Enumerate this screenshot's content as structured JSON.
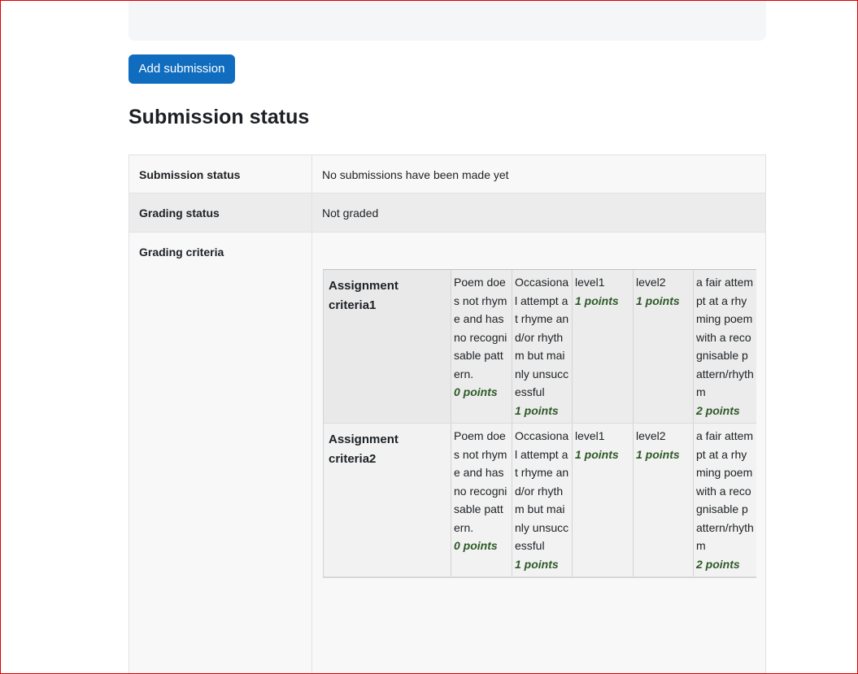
{
  "toolbar": {
    "add_submission_label": "Add submission"
  },
  "page": {
    "title": "Submission status"
  },
  "status_rows": [
    {
      "label": "Submission status",
      "value": "No submissions have been made yet"
    },
    {
      "label": "Grading status",
      "value": "Not graded"
    },
    {
      "label": "Grading criteria",
      "value": ""
    }
  ],
  "rubric": {
    "criteria": [
      {
        "name": "Assignment criteria1",
        "levels": [
          {
            "definition": "Poem does not rhyme and has no recognisable pattern.",
            "points": "0 points"
          },
          {
            "definition": "Occasional attempt at rhyme and/or rhythm but mainly unsuccessful",
            "points": "1 points"
          },
          {
            "definition": "level1",
            "points": "1 points"
          },
          {
            "definition": "level2",
            "points": "1 points"
          },
          {
            "definition": "a fair attempt at a rhyming poem with a recognisable pattern/rhythm",
            "points": "2 points"
          }
        ]
      },
      {
        "name": "Assignment criteria2",
        "levels": [
          {
            "definition": "Poem does not rhyme and has no recognisable pattern.",
            "points": "0 points"
          },
          {
            "definition": "Occasional attempt at rhyme and/or rhythm but mainly unsuccessful",
            "points": "1 points"
          },
          {
            "definition": "level1",
            "points": "1 points"
          },
          {
            "definition": "level2",
            "points": "1 points"
          },
          {
            "definition": "a fair attempt at a rhyming poem with a recognisable pattern/rhythm",
            "points": "2 points"
          }
        ]
      }
    ]
  },
  "colors": {
    "primary_button": "#0f6cbf",
    "points_text": "#2d5a27",
    "frame_border": "#e00000"
  }
}
